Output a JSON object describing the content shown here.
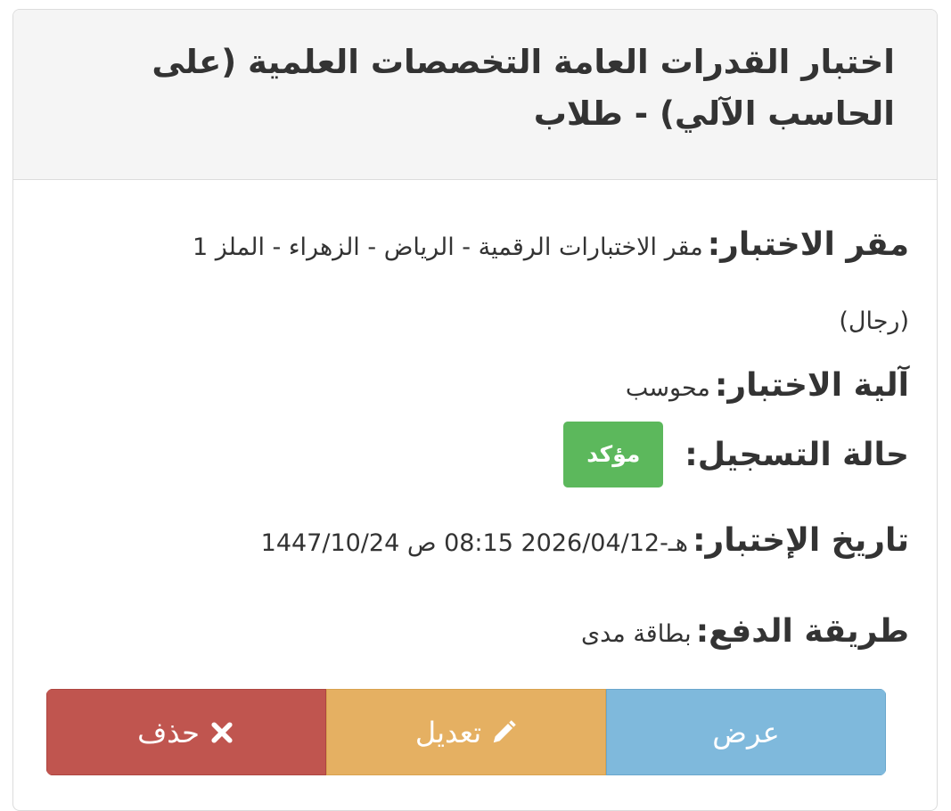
{
  "exam": {
    "title": "اختبار القدرات العامة التخصصات العلمية (على الحاسب الآلي) - طلاب"
  },
  "details": {
    "location_label": "مقر الاختبار:",
    "location_value": "مقر الاختبارات الرقمية - الرياض - الزهراء - الملز 1 (رجال)",
    "method_label": "آلية الاختبار:",
    "method_value": "محوسب",
    "status_label": "حالة التسجيل:",
    "status_badge": "مؤكد",
    "date_label": "تاريخ الإختبار:",
    "date_value": "1447/10/24 هـ-2026/04/12 08:15 ص",
    "payment_label": "طريقة الدفع:",
    "payment_value": "بطاقة مدى"
  },
  "actions": {
    "view_label": "عرض",
    "edit_label": "تعديل",
    "delete_label": "حذف",
    "edit_icon": "pencil-icon",
    "delete_icon": "times-icon"
  },
  "colors": {
    "view": "#7fb9dc",
    "edit": "#e5b062",
    "delete": "#c0554f",
    "badge": "#5cb85c",
    "heading_bg": "#f5f5f5"
  }
}
